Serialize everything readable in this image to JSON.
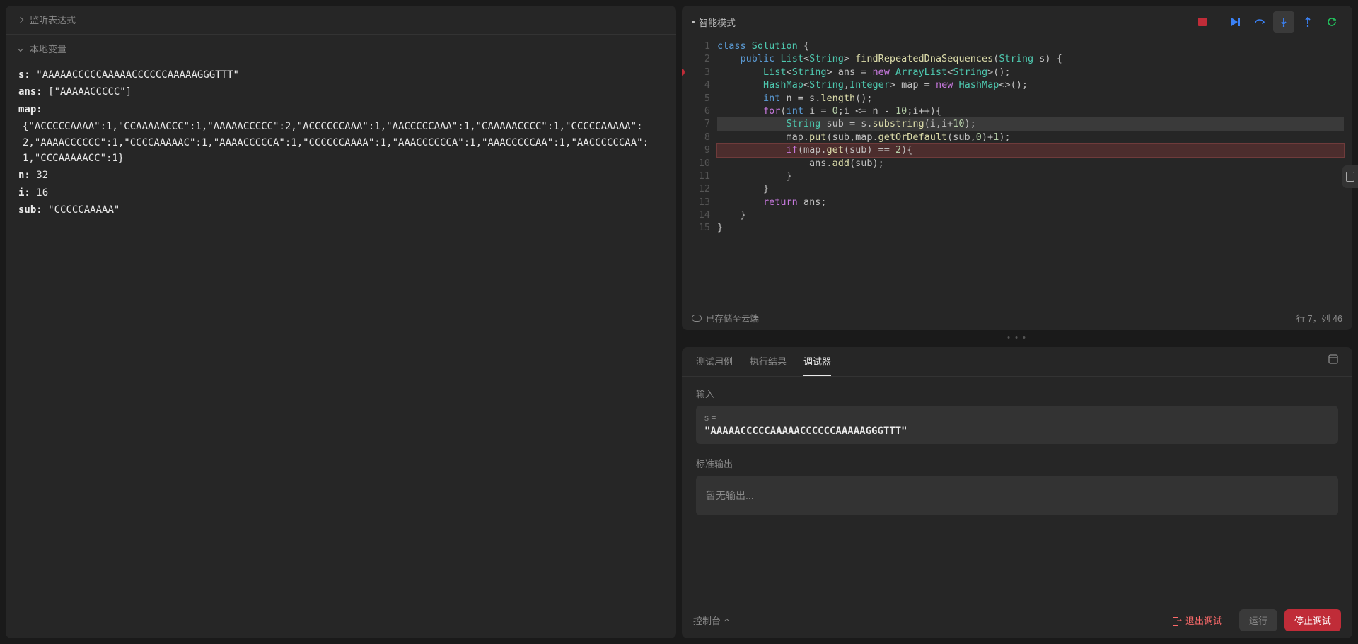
{
  "left": {
    "watch_header": "监听表达式",
    "locals_header": "本地变量",
    "vars": {
      "s": {
        "name": "s:",
        "val": "\"AAAAACCCCCAAAAACCCCCCAAAAAGGGTTT\""
      },
      "ans": {
        "name": "ans:",
        "val": "[\"AAAAACCCCC\"]"
      },
      "map": {
        "name": "map:",
        "val": "{\"ACCCCCAAAA\":1,\"CCAAAAACCC\":1,\"AAAAACCCCC\":2,\"ACCCCCCAAA\":1,\"AACCCCCAAA\":1,\"CAAAAACCCC\":1,\"CCCCCAAAAA\":2,\"AAAACCCCCC\":1,\"CCCCAAAAAC\":1,\"AAAACCCCCA\":1,\"CCCCCCAAAA\":1,\"AAACCCCCCA\":1,\"AAACCCCCAA\":1,\"AACCCCCCAA\":1,\"CCCAAAAACC\":1}"
      },
      "n": {
        "name": "n:",
        "val": "32"
      },
      "i": {
        "name": "i:",
        "val": "16"
      },
      "sub": {
        "name": "sub:",
        "val": "\"CCCCCAAAAA\""
      }
    }
  },
  "editor": {
    "mode": "智能模式",
    "saved": "已存储至云端",
    "cursor": "行 7，列 46",
    "code": [
      {
        "n": 1,
        "html": "<span class='tok-kw'>class</span> <span class='tok-type'>Solution</span> {"
      },
      {
        "n": 2,
        "html": "    <span class='tok-kw'>public</span> <span class='tok-type'>List</span>&lt;<span class='tok-type'>String</span>&gt; <span class='tok-fn'>findRepeatedDnaSequences</span>(<span class='tok-type'>String</span> s) {"
      },
      {
        "n": 3,
        "bp": true,
        "html": "        <span class='tok-type'>List</span>&lt;<span class='tok-type'>String</span>&gt; ans = <span class='tok-kw2'>new</span> <span class='tok-type'>ArrayList</span>&lt;<span class='tok-type'>String</span>&gt;();"
      },
      {
        "n": 4,
        "html": "        <span class='tok-type'>HashMap</span>&lt;<span class='tok-type'>String</span>,<span class='tok-type'>Integer</span>&gt; map = <span class='tok-kw2'>new</span> <span class='tok-type'>HashMap</span>&lt;&gt;();"
      },
      {
        "n": 5,
        "html": "        <span class='tok-kw'>int</span> n = s.<span class='tok-fn'>length</span>();"
      },
      {
        "n": 6,
        "html": "        <span class='tok-kw2'>for</span>(<span class='tok-kw'>int</span> i = <span class='tok-num'>0</span>;i &lt;= n - <span class='tok-num'>10</span>;i++){"
      },
      {
        "n": 7,
        "cur": true,
        "html": "            <span class='tok-type'>String</span> sub = s.<span class='tok-fn'>substring</span>(i,i+<span class='tok-num'>10</span>);"
      },
      {
        "n": 8,
        "html": "            map.<span class='tok-fn'>put</span>(sub,map.<span class='tok-fn'>getOrDefault</span>(sub,<span class='tok-num'>0</span>)+<span class='tok-num'>1</span>);"
      },
      {
        "n": 9,
        "brk": true,
        "html": "            <span class='tok-kw2'>if</span>(map.<span class='tok-fn'>get</span>(sub) == <span class='tok-num'>2</span>){"
      },
      {
        "n": 10,
        "html": "                ans.<span class='tok-fn'>add</span>(sub);"
      },
      {
        "n": 11,
        "html": "            }"
      },
      {
        "n": 12,
        "html": "        }"
      },
      {
        "n": 13,
        "html": "        <span class='tok-kw2'>return</span> ans;"
      },
      {
        "n": 14,
        "html": "    }"
      },
      {
        "n": 15,
        "html": "}"
      }
    ]
  },
  "console": {
    "tabs": {
      "cases": "测试用例",
      "result": "执行结果",
      "debugger": "调试器"
    },
    "input_label": "输入",
    "input_var": "s =",
    "input_val": "\"AAAAACCCCCAAAAACCCCCCAAAAAGGGTTT\"",
    "stdout_label": "标准输出",
    "stdout_empty": "暂无输出...",
    "footer_label": "控制台",
    "exit": "退出调试",
    "run": "运行",
    "stop": "停止调试"
  }
}
